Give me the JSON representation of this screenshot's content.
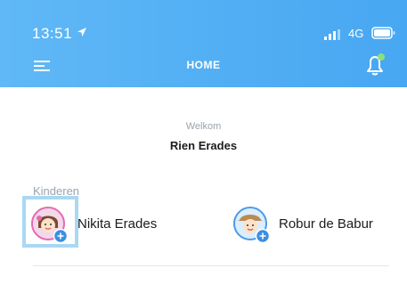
{
  "status_bar": {
    "time": "13:51",
    "network": "4G"
  },
  "header": {
    "title": "HOME"
  },
  "welcome": {
    "label": "Welkom",
    "user_name": "Rien Erades"
  },
  "children": {
    "section_title": "Kinderen",
    "items": [
      {
        "name": "Nikita Erades",
        "avatar": "girl-avatar-icon"
      },
      {
        "name": "Robur de Babur",
        "avatar": "boy-avatar-icon"
      }
    ]
  },
  "colors": {
    "header_start": "#60b8f6",
    "header_end": "#47a7f2",
    "notification_dot": "#8ee07a",
    "add_badge": "#3b8fe0",
    "highlight": "#a9d8f3"
  }
}
